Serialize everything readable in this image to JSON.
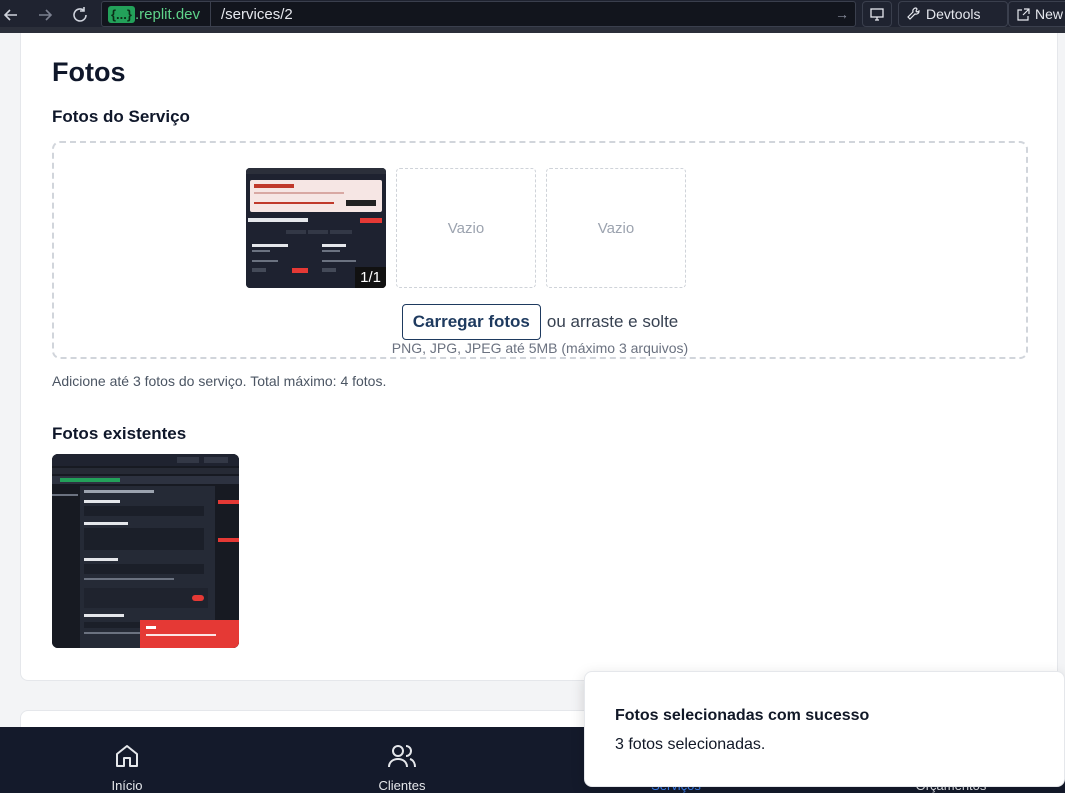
{
  "browser": {
    "url_badge": "{...}",
    "url_domain": ".replit.dev",
    "url_path": "/services/2",
    "devtools_label": "Devtools",
    "new_tab_label": "New"
  },
  "photos_section": {
    "title": "Fotos",
    "subtitle": "Fotos do Serviço",
    "slots": [
      {
        "state": "filled",
        "counter": "1/1"
      },
      {
        "state": "empty",
        "label": "Vazio"
      },
      {
        "state": "empty",
        "label": "Vazio"
      }
    ],
    "upload_button": "Carregar fotos",
    "upload_alt": "ou arraste e solte",
    "formats": "PNG, JPG, JPEG até 5MB (máximo 3 arquivos)",
    "hint": "Adicione até 3 fotos do serviço. Total máximo: 4 fotos.",
    "existing_title": "Fotos existentes"
  },
  "bottom_nav": {
    "items": [
      {
        "label": "Início",
        "icon": "home-icon"
      },
      {
        "label": "Clientes",
        "icon": "users-icon"
      },
      {
        "label": "Serviços",
        "icon": "wrench-icon"
      },
      {
        "label": "Orçamentos",
        "icon": "document-icon"
      }
    ]
  },
  "toast": {
    "title": "Fotos selecionadas com sucesso",
    "message": "3 fotos selecionadas."
  },
  "colors": {
    "accent": "#3b82f6",
    "upload_border": "#1e3a5f",
    "nav_bg": "#141a2b"
  }
}
